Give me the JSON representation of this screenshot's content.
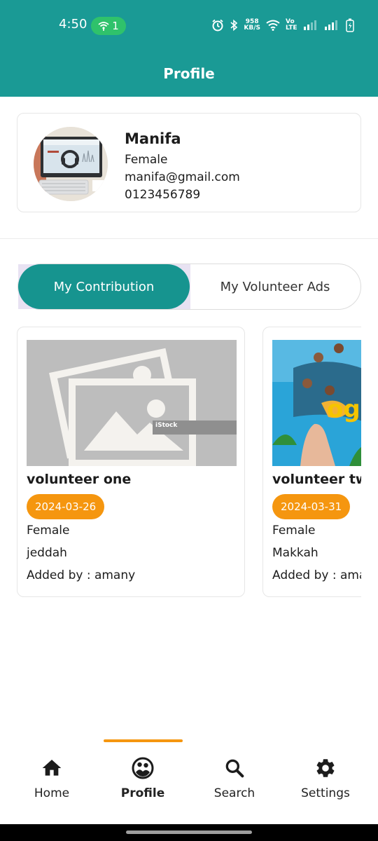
{
  "status_bar": {
    "time": "4:50",
    "hotspot_count": "1",
    "net_speed_value": "958",
    "net_speed_unit": "KB/S",
    "volte": "Vo LTE"
  },
  "app_bar": {
    "title": "Profile"
  },
  "profile": {
    "name": "Manifa",
    "gender": "Female",
    "email": "manifa@gmail.com",
    "phone": "0123456789"
  },
  "tabs": {
    "active": "My Contribution",
    "inactive": "My Volunteer Ads"
  },
  "cards": [
    {
      "title": "volunteer one",
      "date": "2024-03-26",
      "gender": "Female",
      "city": "jeddah",
      "added_by": "Added by : amany",
      "watermark": "iStock"
    },
    {
      "title": "volunteer two",
      "date": "2024-03-31",
      "gender": "Female",
      "city": "Makkah",
      "added_by": "Added by : amany"
    }
  ],
  "bottom_nav": [
    {
      "label": "Home",
      "icon": "home-icon"
    },
    {
      "label": "Profile",
      "icon": "profile-icon",
      "active": true
    },
    {
      "label": "Search",
      "icon": "search-icon"
    },
    {
      "label": "Settings",
      "icon": "gear-icon"
    }
  ],
  "colors": {
    "primary": "#1a9a95",
    "accent": "#f5960f"
  }
}
